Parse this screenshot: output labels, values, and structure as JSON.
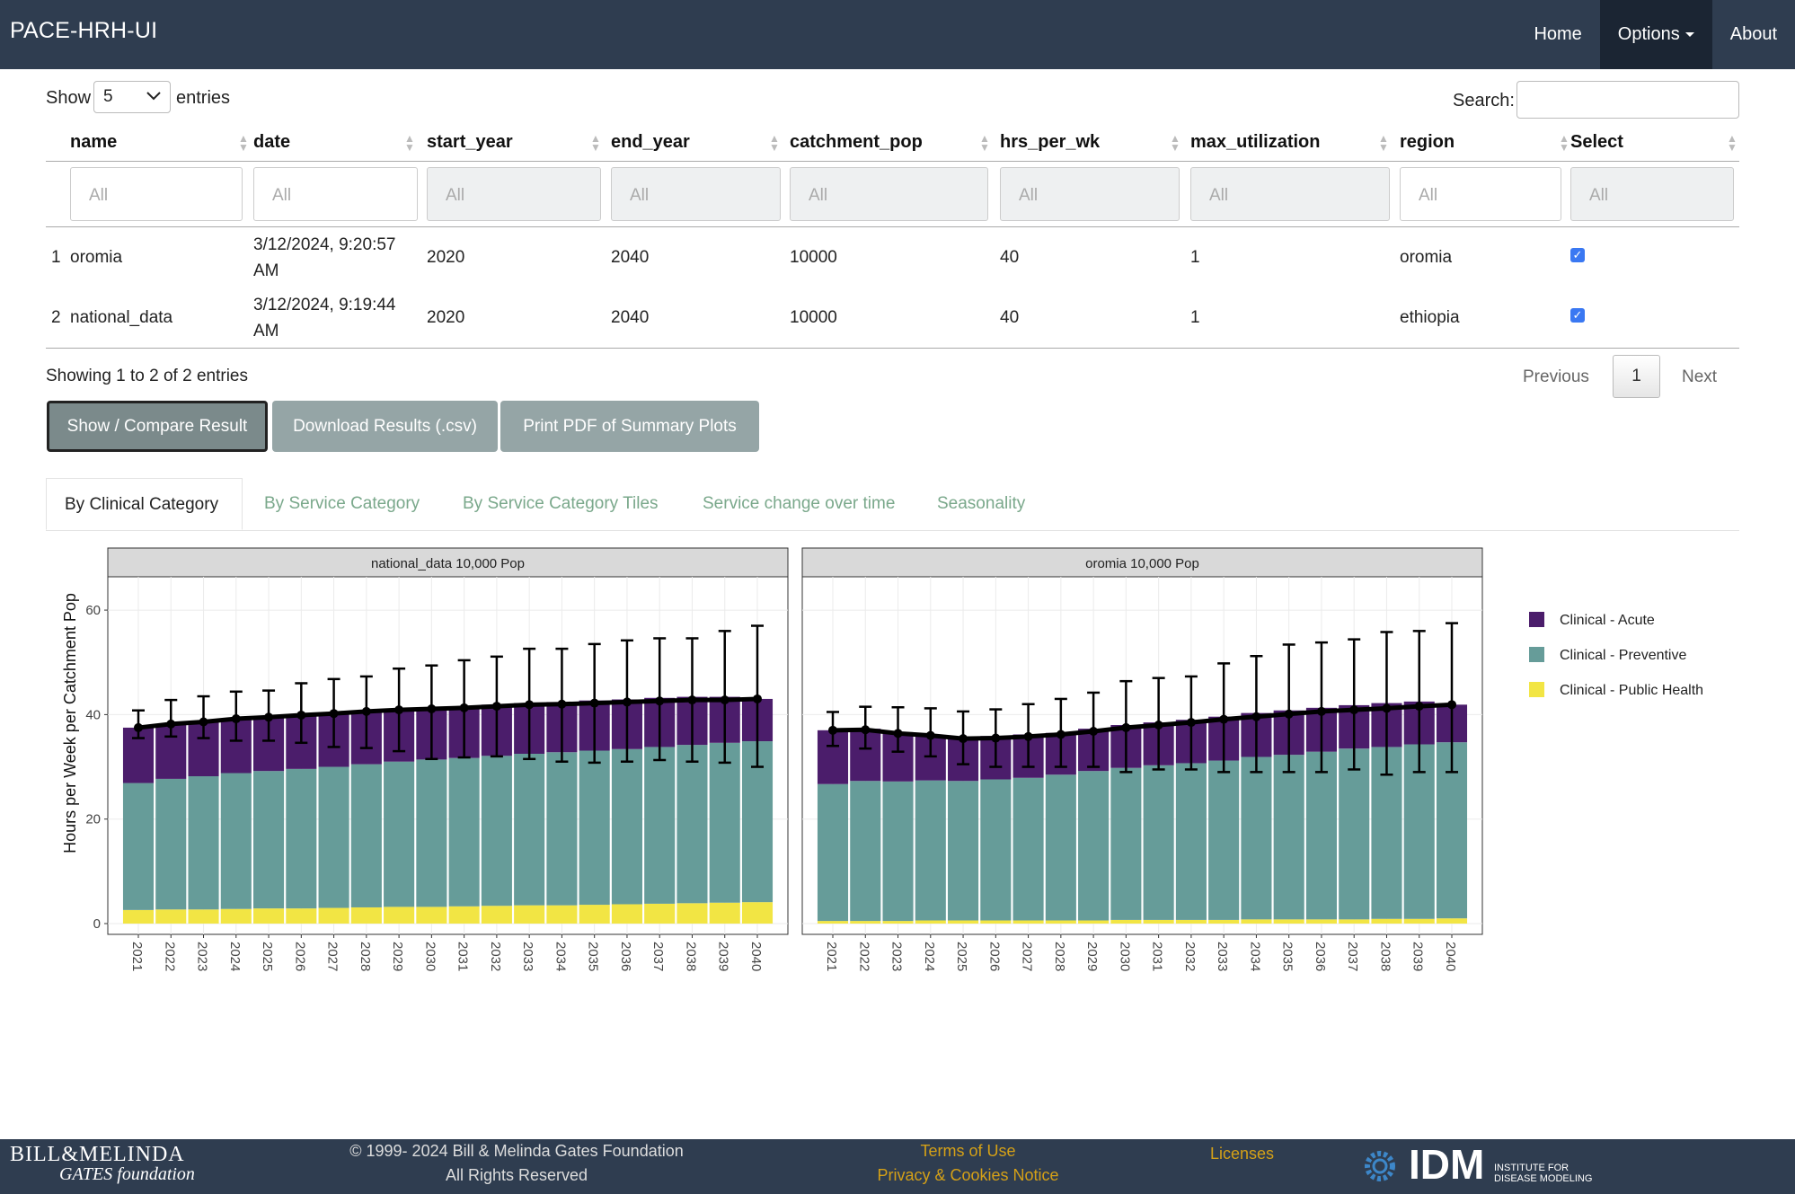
{
  "nav": {
    "brand": "PACE-HRH-UI",
    "home": "Home",
    "options": "Options",
    "about": "About"
  },
  "table_controls": {
    "show": "Show",
    "entries_value": "5",
    "entries": "entries",
    "search_label": "Search:"
  },
  "table": {
    "columns": [
      "name",
      "date",
      "start_year",
      "end_year",
      "catchment_pop",
      "hrs_per_wk",
      "max_utilization",
      "region",
      "Select"
    ],
    "filter_placeholder": "All",
    "rows": [
      {
        "idx": "1",
        "name": "oromia",
        "date_line1": "3/12/2024, 9:20:57",
        "date_line2": "AM",
        "start_year": "2020",
        "end_year": "2040",
        "catchment_pop": "10000",
        "hrs_per_wk": "40",
        "max_utilization": "1",
        "region": "oromia",
        "selected": true
      },
      {
        "idx": "2",
        "name": "national_data",
        "date_line1": "3/12/2024, 9:19:44",
        "date_line2": "AM",
        "start_year": "2020",
        "end_year": "2040",
        "catchment_pop": "10000",
        "hrs_per_wk": "40",
        "max_utilization": "1",
        "region": "ethiopia",
        "selected": true
      }
    ],
    "info": "Showing 1 to 2 of 2 entries",
    "pagination": {
      "previous": "Previous",
      "current": "1",
      "next": "Next"
    }
  },
  "buttons": {
    "compare": "Show / Compare Result",
    "download": "Download Results (.csv)",
    "print": "Print PDF of Summary Plots"
  },
  "tabs": [
    "By Clinical Category",
    "By Service Category",
    "By Service Category Tiles",
    "Service change over time",
    "Seasonality"
  ],
  "colors": {
    "acute": "#4b1d6b",
    "preventive": "#669c99",
    "public_health": "#f2e544",
    "navbar": "#2f3d50",
    "tab_link": "#7aa88b",
    "footer_link": "#d4a017"
  },
  "chart_data": [
    {
      "type": "bar",
      "title": "national_data 10,000 Pop",
      "ylabel": "Hours per Week per Catchment Pop",
      "xlabel": "",
      "ylim": [
        0,
        65
      ],
      "yticks": [
        0,
        20,
        40,
        60
      ],
      "categories": [
        "2021",
        "2022",
        "2023",
        "2024",
        "2025",
        "2026",
        "2027",
        "2028",
        "2029",
        "2030",
        "2031",
        "2032",
        "2033",
        "2034",
        "2035",
        "2036",
        "2037",
        "2038",
        "2039",
        "2040"
      ],
      "stacked": true,
      "series": [
        {
          "name": "Clinical - Public Health",
          "values": [
            2.6,
            2.7,
            2.7,
            2.8,
            2.9,
            2.9,
            3.0,
            3.1,
            3.2,
            3.2,
            3.3,
            3.4,
            3.5,
            3.5,
            3.6,
            3.7,
            3.8,
            3.9,
            4.0,
            4.1
          ]
        },
        {
          "name": "Clinical - Preventive",
          "values": [
            24.3,
            25.0,
            25.5,
            26.0,
            26.3,
            26.7,
            27.0,
            27.4,
            27.8,
            28.2,
            28.4,
            28.7,
            29.0,
            29.3,
            29.5,
            29.7,
            30.0,
            30.3,
            30.6,
            30.8
          ]
        },
        {
          "name": "Clinical - Acute",
          "values": [
            10.6,
            10.5,
            10.4,
            10.4,
            10.3,
            10.3,
            10.2,
            10.1,
            10.0,
            9.9,
            9.8,
            9.8,
            9.7,
            9.6,
            9.6,
            9.5,
            9.4,
            9.2,
            8.8,
            8.1
          ]
        }
      ],
      "line": {
        "values": [
          37.5,
          38.2,
          38.6,
          39.2,
          39.5,
          39.9,
          40.2,
          40.6,
          40.9,
          41.1,
          41.3,
          41.6,
          41.9,
          42.0,
          42.2,
          42.4,
          42.6,
          42.8,
          42.8,
          43.0
        ]
      },
      "errorbars": {
        "lower": [
          35.5,
          35.8,
          35.5,
          35.0,
          35.0,
          34.6,
          33.8,
          33.6,
          33.0,
          31.5,
          31.8,
          32.0,
          31.5,
          31.0,
          30.8,
          31.0,
          31.3,
          31.0,
          30.8,
          30.0
        ],
        "upper": [
          40.8,
          42.8,
          43.5,
          44.4,
          44.6,
          46.0,
          46.8,
          47.3,
          48.8,
          49.4,
          50.4,
          51.1,
          52.6,
          52.6,
          53.5,
          54.2,
          54.6,
          54.6,
          56.0,
          57.0
        ]
      },
      "legend": "right"
    },
    {
      "type": "bar",
      "title": "oromia 10,000 Pop",
      "ylabel": "",
      "xlabel": "",
      "ylim": [
        0,
        65
      ],
      "yticks": [
        0,
        20,
        40,
        60
      ],
      "categories": [
        "2021",
        "2022",
        "2023",
        "2024",
        "2025",
        "2026",
        "2027",
        "2028",
        "2029",
        "2030",
        "2031",
        "2032",
        "2033",
        "2034",
        "2035",
        "2036",
        "2037",
        "2038",
        "2039",
        "2040"
      ],
      "stacked": true,
      "series": [
        {
          "name": "Clinical - Public Health",
          "values": [
            0.5,
            0.5,
            0.5,
            0.6,
            0.6,
            0.6,
            0.6,
            0.6,
            0.6,
            0.7,
            0.7,
            0.7,
            0.7,
            0.8,
            0.8,
            0.8,
            0.8,
            0.9,
            0.9,
            1.0
          ]
        },
        {
          "name": "Clinical - Preventive",
          "values": [
            26.2,
            26.8,
            26.7,
            26.8,
            26.7,
            27.0,
            27.3,
            27.9,
            28.6,
            29.1,
            29.6,
            30.0,
            30.5,
            31.1,
            31.5,
            32.1,
            32.7,
            32.9,
            33.4,
            33.7
          ]
        },
        {
          "name": "Clinical - Acute",
          "values": [
            10.3,
            10.0,
            9.2,
            8.7,
            8.5,
            8.3,
            8.3,
            8.0,
            8.1,
            8.2,
            8.2,
            8.3,
            8.4,
            8.4,
            8.5,
            8.4,
            8.3,
            8.4,
            8.2,
            7.2
          ]
        }
      ],
      "line": {
        "values": [
          37.0,
          37.1,
          36.4,
          36.0,
          35.4,
          35.5,
          35.8,
          36.2,
          36.8,
          37.5,
          38.0,
          38.5,
          39.1,
          39.6,
          40.1,
          40.6,
          40.9,
          41.2,
          41.6,
          41.9
        ]
      },
      "errorbars": {
        "lower": [
          34.0,
          33.5,
          32.9,
          32.0,
          30.5,
          30.0,
          30.0,
          30.0,
          30.0,
          29.0,
          29.5,
          29.5,
          29.0,
          29.0,
          29.0,
          29.0,
          29.5,
          28.5,
          29.0,
          29.0
        ],
        "upper": [
          40.5,
          41.5,
          41.4,
          41.2,
          40.6,
          41.0,
          42.0,
          43.0,
          44.2,
          46.4,
          47.0,
          47.3,
          49.8,
          51.2,
          53.4,
          53.8,
          54.4,
          55.8,
          56.0,
          57.5
        ]
      },
      "legend": "right"
    }
  ],
  "legend": {
    "items": [
      {
        "label": "Clinical - Acute",
        "color": "#4b1d6b"
      },
      {
        "label": "Clinical - Preventive",
        "color": "#669c99"
      },
      {
        "label": "Clinical - Public Health",
        "color": "#f2e544"
      }
    ]
  },
  "footer": {
    "logo_line1": "BILL&MELINDA",
    "logo_line2": "GATES foundation",
    "copyright_line1": "© 1999- 2024 Bill & Melinda Gates Foundation",
    "copyright_line2": "All Rights Reserved",
    "terms": "Terms of Use",
    "privacy": "Privacy & Cookies Notice",
    "licenses": "Licenses",
    "idm": "IDM",
    "idm_sub1": "INSTITUTE FOR",
    "idm_sub2": "DISEASE MODELING"
  }
}
